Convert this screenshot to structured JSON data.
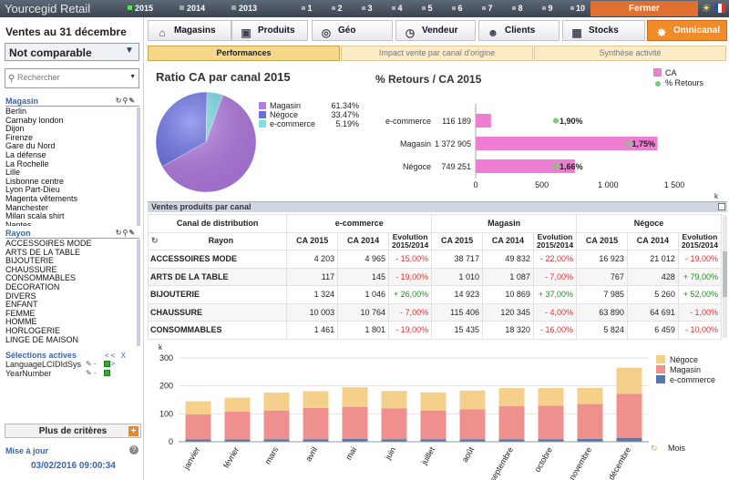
{
  "app": {
    "title": "Yourcegid Retail",
    "close_label": "Fermer"
  },
  "years": [
    {
      "label": "2015",
      "active": true
    },
    {
      "label": "2014",
      "active": false
    },
    {
      "label": "2013",
      "active": false
    }
  ],
  "months": [
    "1",
    "2",
    "3",
    "4",
    "5",
    "6",
    "7",
    "8",
    "9",
    "10"
  ],
  "left": {
    "date_title": "Ventes au 31 décembre",
    "compare_value": "Not comparable",
    "search_placeholder": "Rechercher",
    "magasin_label": "Magasin",
    "magasins": [
      "Berlin",
      "Carnaby london",
      "Dijon",
      "Firenze",
      "Gare du Nord",
      "La défense",
      "La Rochelle",
      "Lille",
      "Lisbonne centre",
      "Lyon Part-Dieu",
      "Magenta vêtements",
      "Manchester",
      "Milan scala shirt",
      "Nantes"
    ],
    "rayon_label": "Rayon",
    "rayons": [
      "ACCESSOIRES MODE",
      "ARTS DE LA TABLE",
      "BIJOUTERIE",
      "CHAUSSURE",
      "CONSOMMABLES",
      "DECORATION",
      "DIVERS",
      "ENFANT",
      "FEMME",
      "HOMME",
      "HORLOGERIE",
      "LINGE DE MAISON"
    ],
    "active_label": "Sélections actives",
    "active_nav": "<< X >>",
    "active_items": [
      "LanguageLCIDIdSys",
      "YearNumber"
    ],
    "more_label": "Plus de critères",
    "update_label": "Mise à jour",
    "update_value": "03/02/2016 09:00:34"
  },
  "tabs": [
    {
      "label": "Magasins",
      "icon": "store-icon"
    },
    {
      "label": "Produits",
      "icon": "bag-icon"
    },
    {
      "label": "Géo",
      "icon": "globe-icon"
    },
    {
      "label": "Vendeur",
      "icon": "clock-icon"
    },
    {
      "label": "Clients",
      "icon": "users-icon"
    },
    {
      "label": "Stocks",
      "icon": "warehouse-icon"
    },
    {
      "label": "Omnicanal",
      "icon": "network-icon",
      "active": true
    }
  ],
  "subtabs": [
    {
      "label": "Performances",
      "active": true
    },
    {
      "label": "Impact vente par canal d'origine"
    },
    {
      "label": "Synthèse activité"
    }
  ],
  "pie": {
    "title": "Ratio CA par canal 2015",
    "chart_data": {
      "type": "pie",
      "categories": [
        "Magasin",
        "Négoce",
        "e-commerce"
      ],
      "values": [
        61.34,
        33.47,
        5.19
      ],
      "labels": [
        "61.34%",
        "33.47%",
        "5.19%"
      ],
      "colors": [
        "#b47ce6",
        "#6870e8",
        "#7ce0ec"
      ]
    }
  },
  "returns": {
    "title": "% Retours / CA 2015",
    "legend": [
      "CA",
      "% Retours"
    ],
    "chart_data": {
      "type": "bar",
      "categories": [
        "e-commerce",
        "Magasin",
        "Négoce"
      ],
      "values": [
        116.189,
        1372.905,
        749.251
      ],
      "value_labels": [
        "116 189",
        "1 372 905",
        "749 251"
      ],
      "returns_pct": [
        "1,90%",
        "1,75%",
        "1,66%"
      ],
      "xticks": [
        "0",
        "500",
        "1 000",
        "1 500"
      ],
      "xunit": "k",
      "xlim": [
        0,
        1500
      ]
    }
  },
  "table": {
    "title": "Ventes produits par canal",
    "head1": "Canal de distribution",
    "channels": [
      "e-commerce",
      "Magasin",
      "Négoce"
    ],
    "head2": "Rayon",
    "cols": [
      "CA 2015",
      "CA 2014",
      "Evolution 2015/2014"
    ],
    "rows": [
      {
        "name": "ACCESSOIRES MODE",
        "v": [
          "4 203",
          "4 965",
          "- 15,00%",
          "38 717",
          "49 832",
          "- 22,00%",
          "16 923",
          "21 012",
          "- 19,00%"
        ]
      },
      {
        "name": "ARTS DE LA TABLE",
        "v": [
          "117",
          "145",
          "- 19,00%",
          "1 010",
          "1 087",
          "- 7,00%",
          "767",
          "428",
          "+ 79,00%"
        ]
      },
      {
        "name": "BIJOUTERIE",
        "v": [
          "1 324",
          "1 046",
          "+ 26,00%",
          "14 923",
          "10 869",
          "+ 37,00%",
          "7 985",
          "5 260",
          "+ 52,00%"
        ]
      },
      {
        "name": "CHAUSSURE",
        "v": [
          "10 003",
          "10 764",
          "- 7,00%",
          "115 406",
          "120 345",
          "- 4,00%",
          "63 890",
          "64 691",
          "- 1,00%"
        ]
      },
      {
        "name": "CONSOMMABLES",
        "v": [
          "1 461",
          "1 801",
          "- 19,00%",
          "15 435",
          "18 320",
          "- 16,00%",
          "5 824",
          "6 459",
          "- 10,00%"
        ]
      }
    ]
  },
  "monthly": {
    "chart_data": {
      "type": "bar",
      "stacked": true,
      "categories": [
        "janvier",
        "février",
        "mars",
        "avril",
        "mai",
        "juin",
        "juillet",
        "août",
        "septembre",
        "octobre",
        "novembre",
        "décembre"
      ],
      "series": [
        {
          "name": "e-commerce",
          "color": "#5577aa",
          "values": [
            8,
            8,
            9,
            9,
            10,
            9,
            9,
            9,
            9,
            9,
            10,
            14
          ]
        },
        {
          "name": "Magasin",
          "color": "#f0908e",
          "values": [
            90,
            100,
            103,
            112,
            115,
            110,
            103,
            107,
            118,
            120,
            125,
            158
          ]
        },
        {
          "name": "Négoce",
          "color": "#f5d08a",
          "values": [
            47,
            50,
            64,
            60,
            70,
            63,
            65,
            67,
            65,
            63,
            58,
            93
          ]
        }
      ],
      "yticks": [
        "0",
        "100",
        "200",
        "300"
      ],
      "ylim": [
        0,
        300
      ],
      "yunit": "k",
      "xlabel": "Mois"
    }
  }
}
